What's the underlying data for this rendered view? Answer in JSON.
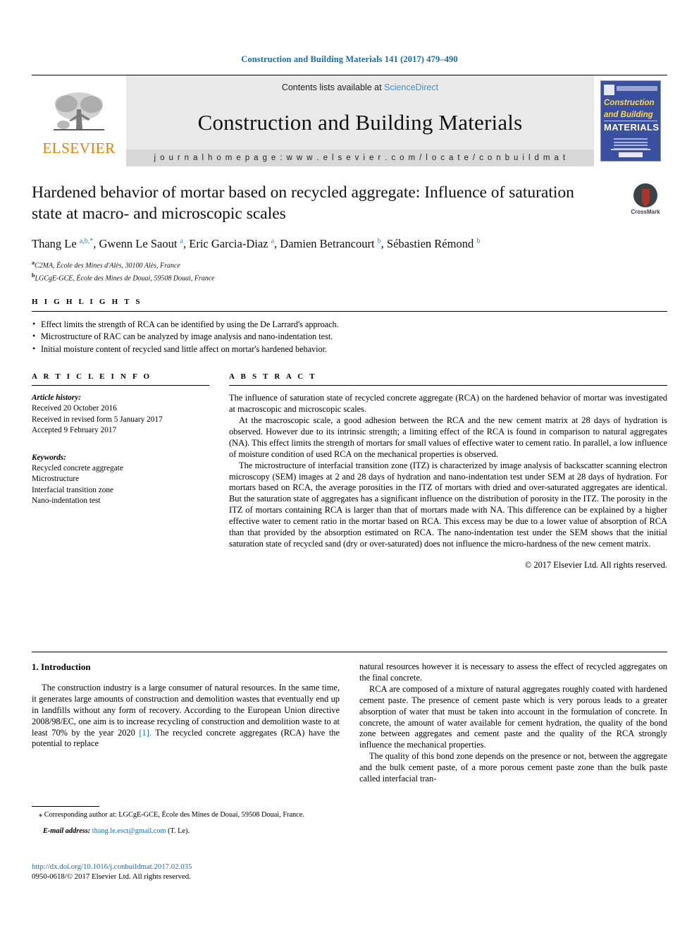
{
  "running_head": "Construction and Building Materials 141 (2017) 479–490",
  "masthead": {
    "contents_prefix": "Contents lists available at ",
    "contents_link": "ScienceDirect",
    "journal_title": "Construction and Building Materials",
    "homepage": "j o u r n a l   h o m e p a g e :   w w w . e l s e v i e r . c o m / l o c a t e / c o n b u i l d m a t",
    "publisher_name": "ELSEVIER",
    "cover": {
      "line1": "Construction",
      "line2": "and Building",
      "line3": "MATERIALS"
    }
  },
  "article": {
    "title": "Hardened behavior of mortar based on recycled aggregate: Influence of saturation state at macro- and microscopic scales",
    "crossmark_label": "CrossMark",
    "authors_html": "Thang Le <sup>a,b,</sup><sup>*</sup>, Gwenn Le Saout <sup>a</sup>, Eric Garcia-Diaz <sup>a</sup>, Damien Betrancourt <sup>b</sup>, Sébastien Rémond <sup>b</sup>",
    "affiliations": [
      {
        "marker": "a",
        "text": "C2MA, École des Mines d'Alès, 30100 Alès, France"
      },
      {
        "marker": "b",
        "text": "LGCgE-GCE, École des Mines de Douai, 59508 Douai, France"
      }
    ]
  },
  "highlights": {
    "heading": "H I G H L I G H T S",
    "items": [
      "Effect limits the strength of RCA can be identified by using the De Larrard's approach.",
      "Microstructure of RAC can be analyzed by image analysis and nano-indentation test.",
      "Initial moisture content of recycled sand little affect on mortar's hardened behavior."
    ]
  },
  "article_info": {
    "heading": "A R T I C L E   I N F O",
    "history_label": "Article history:",
    "history": [
      "Received 20 October 2016",
      "Received in revised form 5 January 2017",
      "Accepted 9 February 2017"
    ],
    "keywords_label": "Keywords:",
    "keywords": [
      "Recycled concrete aggregate",
      "Microstructure",
      "Interfacial transition zone",
      "Nano-indentation test"
    ]
  },
  "abstract": {
    "heading": "A B S T R A C T",
    "paragraphs": [
      "The influence of saturation state of recycled concrete aggregate (RCA) on the hardened behavior of mortar was investigated at macroscopic and microscopic scales.",
      "At the macroscopic scale, a good adhesion between the RCA and the new cement matrix at 28 days of hydration is observed. However due to its intrinsic strength; a limiting effect of the RCA is found in comparison to natural aggregates (NA). This effect limits the strength of mortars for small values of effective water to cement ratio. In parallel, a low influence of moisture condition of used RCA on the mechanical properties is observed.",
      "The microstructure of interfacial transition zone (ITZ) is characterized by image analysis of backscatter scanning electron microscopy (SEM) images at 2 and 28 days of hydration and nano-indentation test under SEM at 28 days of hydration. For mortars based on RCA, the average porosities in the ITZ of mortars with dried and over-saturated aggregates are identical. But the saturation state of aggregates has a significant influence on the distribution of porosity in the ITZ. The porosity in the ITZ of mortars containing RCA is larger than that of mortars made with NA. This difference can be explained by a higher effective water to cement ratio in the mortar based on RCA. This excess may be due to a lower value of absorption of RCA than that provided by the absorption estimated on RCA. The nano-indentation test under the SEM shows that the initial saturation state of recycled sand (dry or over-saturated) does not influence the micro-hardness of the new cement matrix."
    ],
    "copyright": "© 2017 Elsevier Ltd. All rights reserved."
  },
  "body": {
    "section_heading": "1. Introduction",
    "left_paragraphs": [
      "The construction industry is a large consumer of natural resources. In the same time, it generates large amounts of construction and demolition wastes that eventually end up in landfills without any form of recovery. According to the European Union directive 2008/98/EC, one aim is to increase recycling of construction and demolition waste to at least 70% by the year 2020 ",
      " The recycled concrete aggregates (RCA) have the potential to replace"
    ],
    "citation_1": "[1].",
    "right_paragraphs": [
      "natural resources however it is necessary to assess the effect of recycled aggregates on the final concrete.",
      "RCA are composed of a mixture of natural aggregates roughly coated with hardened cement paste. The presence of cement paste which is very porous leads to a greater absorption of water that must be taken into account in the formulation of concrete. In concrete, the amount of water available for cement hydration, the quality of the bond zone between aggregates and cement paste and the quality of the RCA strongly influence the mechanical properties.",
      "The quality of this bond zone depends on the presence or not, between the aggregate and the bulk cement paste, of a more porous cement paste zone than the bulk paste called interfacial tran-"
    ]
  },
  "footnotes": {
    "corresponding": "⁎ Corresponding author at: LGCgE-GCE, École des Mines de Douai, 59508 Douai, France.",
    "email_label": "E-mail address:",
    "email": "thang.le.esct@gmail.com",
    "email_suffix": " (T. Le).",
    "doi": "http://dx.doi.org/10.1016/j.conbuildmat.2017.02.035",
    "issn_copyright": "0950-0618/© 2017 Elsevier Ltd. All rights reserved."
  }
}
